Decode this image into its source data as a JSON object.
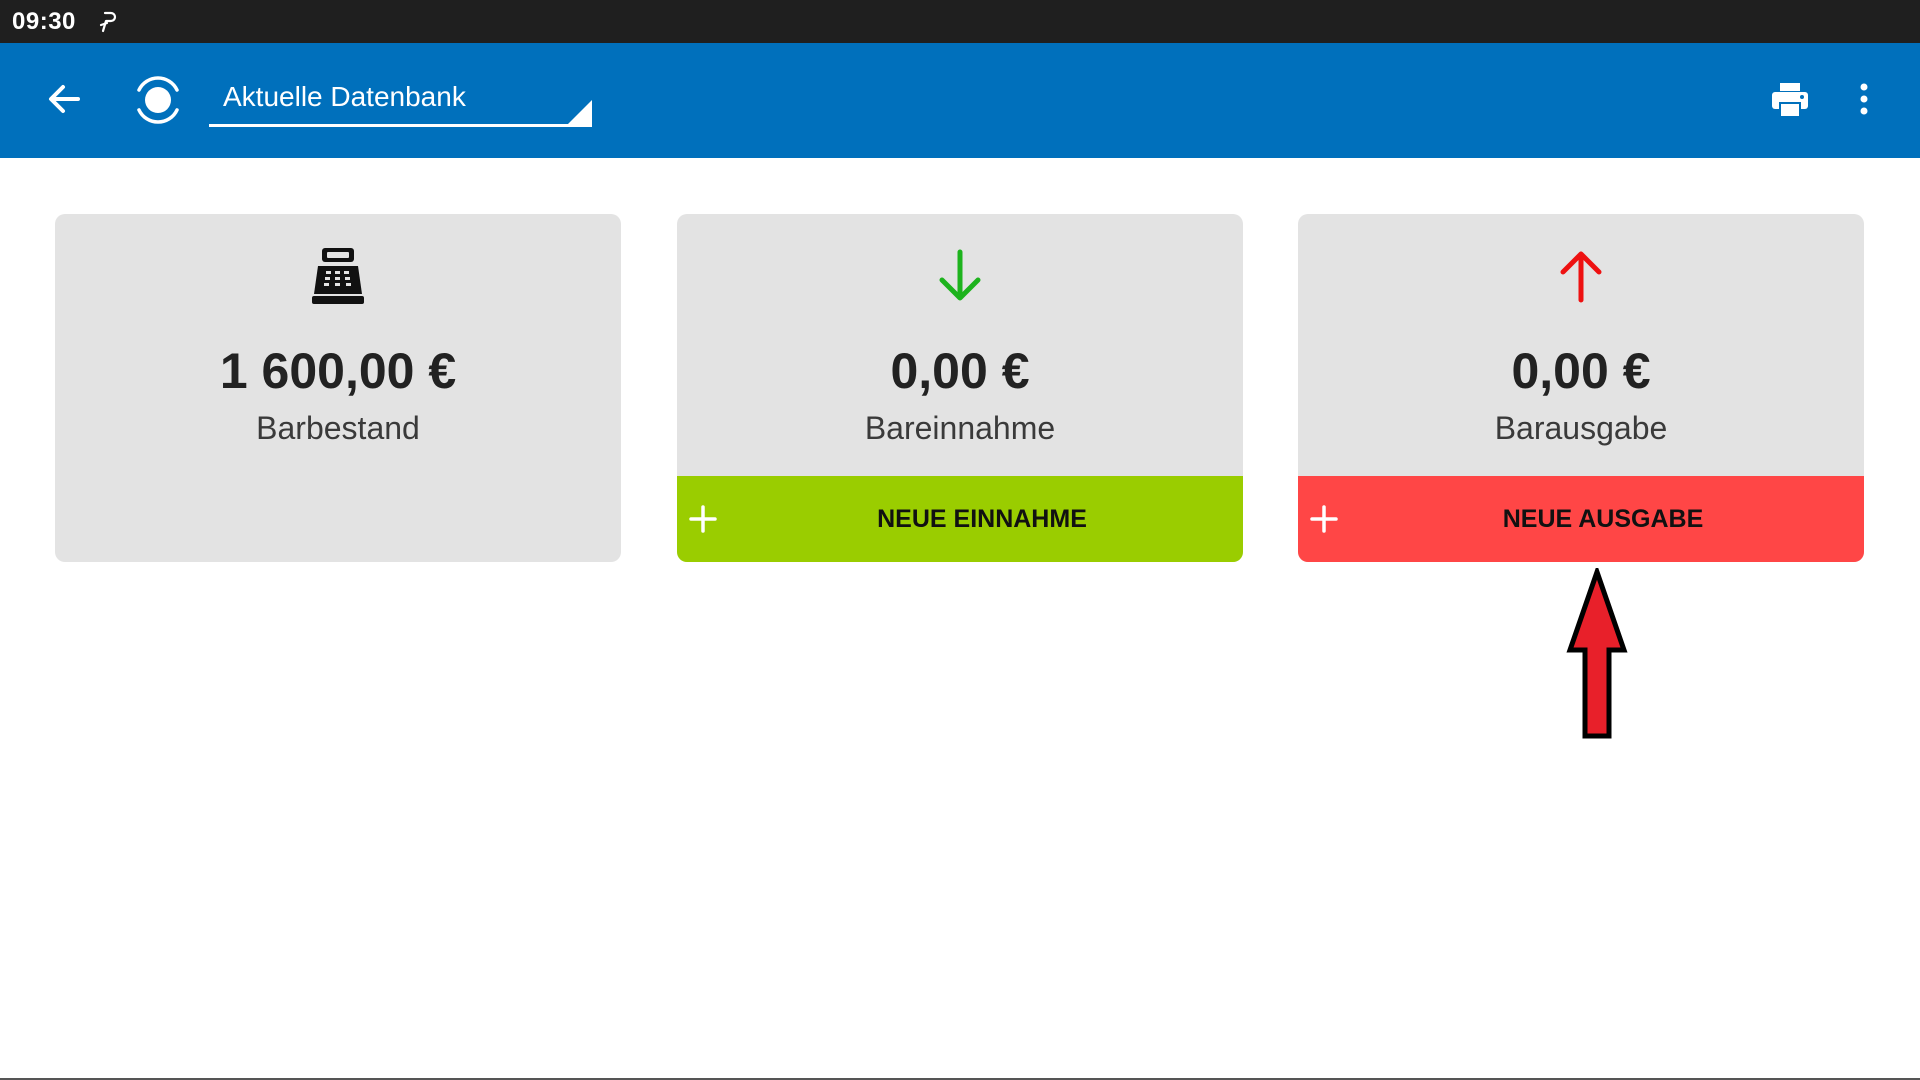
{
  "status_bar": {
    "time": "09:30",
    "notification_icon": "p-notification-icon"
  },
  "app_bar": {
    "back_icon": "arrow-left-icon",
    "logo_icon": "app-logo-icon",
    "database_select": {
      "value": "Aktuelle Datenbank"
    },
    "print_icon": "printer-icon",
    "more_icon": "more-vertical-icon"
  },
  "cards": [
    {
      "icon": "cash-register-icon",
      "amount": "1 600,00 €",
      "caption": "Barbestand"
    },
    {
      "icon": "arrow-down-icon",
      "icon_color": "#1db31d",
      "amount": "0,00 €",
      "caption": "Bareinnahme",
      "action": {
        "label": "NEUE EINNAHME",
        "color": "#9acd00"
      }
    },
    {
      "icon": "arrow-up-icon",
      "icon_color": "#ee1111",
      "amount": "0,00 €",
      "caption": "Barausgabe",
      "action": {
        "label": "NEUE AUSGABE",
        "color": "#ff4646"
      }
    }
  ],
  "colors": {
    "app_bar": "#0070bc",
    "status_bar": "#1f1f1f",
    "card_bg": "#e3e3e3",
    "annotation_arrow": "#e8202a"
  }
}
